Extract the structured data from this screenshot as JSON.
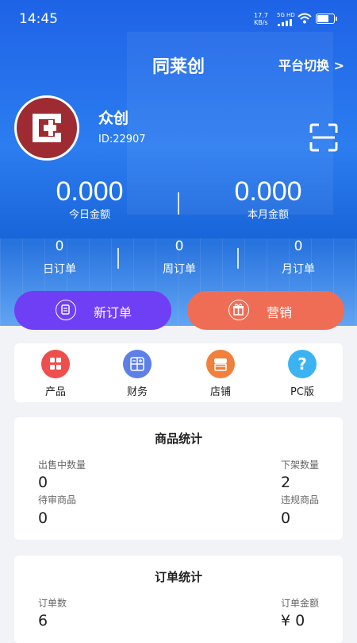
{
  "status": {
    "time": "14:45",
    "speed": "17.7",
    "speed_unit": "KB/s",
    "network": "5G HD"
  },
  "header": {
    "title": "同莱创",
    "switch_label": "平台切换 >"
  },
  "profile": {
    "name": "众创",
    "id": "ID:22907"
  },
  "amounts": [
    {
      "value": "0.000",
      "label": "今日金额"
    },
    {
      "value": "0.000",
      "label": "本月金额"
    }
  ],
  "orders": [
    {
      "value": "0",
      "label": "日订单"
    },
    {
      "value": "0",
      "label": "周订单"
    },
    {
      "value": "0",
      "label": "月订单"
    }
  ],
  "actions": {
    "new_order": "新订单",
    "marketing": "营销"
  },
  "quick_menu": [
    {
      "label": "产品",
      "color": "#ef4e4e",
      "icon": "grid-icon"
    },
    {
      "label": "财务",
      "color": "#5d7fe8",
      "icon": "calculator-icon"
    },
    {
      "label": "店铺",
      "color": "#f0803c",
      "icon": "store-icon"
    },
    {
      "label": "PC版",
      "color": "#3bb3f0",
      "icon": "question-icon"
    }
  ],
  "goods_stats": {
    "title": "商品统计",
    "on_sale_label": "出售中数量",
    "on_sale_value": "0",
    "off_shelf_label": "下架数量",
    "off_shelf_value": "2",
    "pending_label": "待审商品",
    "pending_value": "0",
    "violation_label": "违规商品",
    "violation_value": "0"
  },
  "order_stats": {
    "title": "订单统计",
    "count_label": "订单数",
    "count_value": "6",
    "amount_label": "订单金额",
    "amount_value": "¥ 0"
  },
  "colors": {
    "primary": "#1e63e6",
    "purple": "#6f3ff5",
    "coral": "#f06d55",
    "page_bg": "#f2f3f7"
  }
}
